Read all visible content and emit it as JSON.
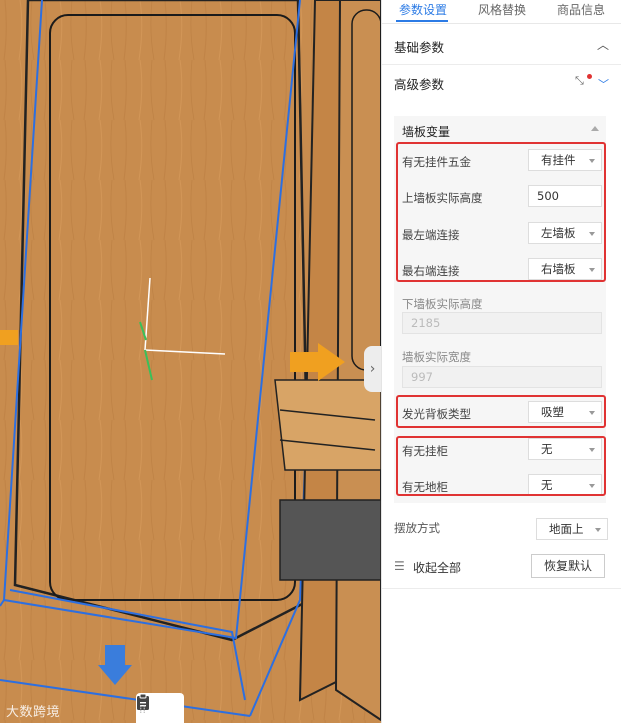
{
  "tabs": [
    "参数设置",
    "风格替换",
    "商品信息"
  ],
  "sections": {
    "basic": "基础参数",
    "advanced": "高级参数"
  },
  "group": {
    "title": "墙板变量",
    "fields": [
      {
        "label": "有无挂件五金",
        "type": "select",
        "value": "有挂件"
      },
      {
        "label": "上墙板实际高度",
        "type": "input",
        "value": "500"
      },
      {
        "label": "最左端连接",
        "type": "select",
        "value": "左墙板"
      },
      {
        "label": "最右端连接",
        "type": "select",
        "value": "右墙板"
      },
      {
        "label": "下墙板实际高度",
        "type": "disabled",
        "value": "2185"
      },
      {
        "label": "墙板实际宽度",
        "type": "disabled",
        "value": "997"
      },
      {
        "label": "发光背板类型",
        "type": "select",
        "value": "吸塑"
      },
      {
        "label": "有无挂柜",
        "type": "select",
        "value": "无"
      },
      {
        "label": "有无地柜",
        "type": "select",
        "value": "无"
      }
    ]
  },
  "placement": {
    "label": "摆放方式",
    "value": "地面上"
  },
  "footer": {
    "collapse_label": "收起全部",
    "reset_label": "恢复默认"
  },
  "watermark": "大数跨境",
  "colors": {
    "accent": "#2c7be5",
    "highlight": "#e03333",
    "wood": "#c78a4c"
  }
}
